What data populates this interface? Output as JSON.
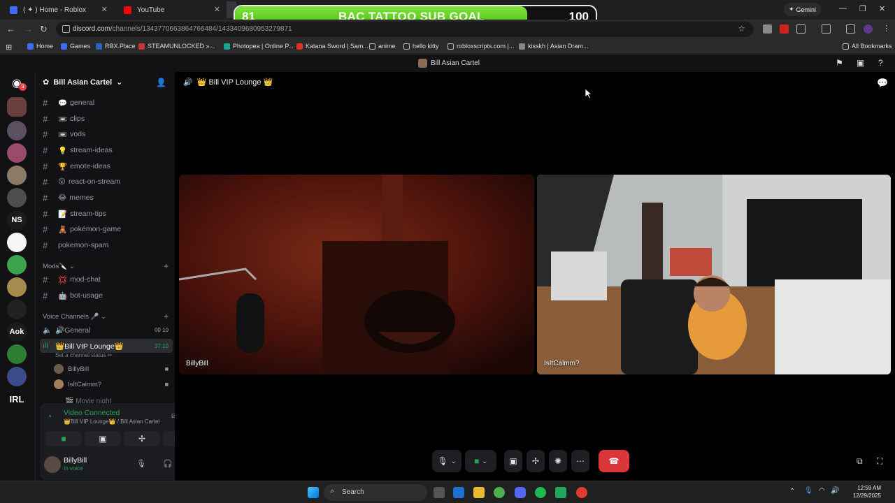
{
  "browser": {
    "tabs": [
      {
        "title": "( ✦ ) Home - Roblox"
      },
      {
        "title": "YouTube"
      }
    ],
    "gemini_label": "Gemini",
    "url_host": "discord.com",
    "url_path": "/channels/1343770663864766484/1433409680953279871",
    "bookmarks": [
      {
        "label": "Home"
      },
      {
        "label": "Games"
      },
      {
        "label": "RBX.Place"
      },
      {
        "label": "STEAMUNLOCKED »..."
      },
      {
        "label": "Photopea | Online P..."
      },
      {
        "label": "Katana Sword | Sam..."
      },
      {
        "label": "anime"
      },
      {
        "label": "hello kitty"
      },
      {
        "label": "robloxscripts.com |..."
      },
      {
        "label": "kisskh | Asian Dram..."
      }
    ],
    "all_bookmarks": "All Bookmarks"
  },
  "sub_goal": {
    "current": "81",
    "target": "100",
    "label": "BAC TATTOO SUB GOAL",
    "progress_fraction": 0.81
  },
  "discord": {
    "window_title": "Bill Asian Cartel",
    "notif_count": "3",
    "server_name": "Bill Asian Cartel",
    "rail_labels": {
      "ns": "NS",
      "aok": "Aok",
      "irl": "IRL"
    },
    "channels": [
      {
        "emoji": "💬",
        "name": "general"
      },
      {
        "emoji": "📼",
        "name": "clips"
      },
      {
        "emoji": "📼",
        "name": "vods"
      },
      {
        "emoji": "💡",
        "name": "stream-ideas"
      },
      {
        "emoji": "🏆",
        "name": "emote-ideas"
      },
      {
        "emoji": "😲",
        "name": "react-on-stream"
      },
      {
        "emoji": "😂",
        "name": "memes"
      },
      {
        "emoji": "📝",
        "name": "stream-tips"
      },
      {
        "emoji": "🧸",
        "name": "pokémon-game"
      },
      {
        "emoji": "",
        "name": "pokemon-spam"
      }
    ],
    "mods_category": "Mods🔪",
    "mod_channels": [
      {
        "emoji": "💢",
        "name": "mod-chat"
      },
      {
        "emoji": "🤖",
        "name": "bot-usage"
      }
    ],
    "voice_category": "Voice Channels 🎤",
    "voice_channels": [
      {
        "name": "🔊General",
        "badge": "00 10"
      },
      {
        "name": "👑Bill VIP Lounge👑",
        "badge": "37:10",
        "status": "Set a channel status ✏"
      }
    ],
    "voice_users": [
      {
        "name": "BillyBill"
      },
      {
        "name": "IsItCalmm?"
      }
    ],
    "next_channel": "🎬 Movie night",
    "connection": {
      "status": "Video Connected",
      "location": "👑Bill VIP Lounge👑 / Bill Asian Cartel"
    },
    "user": {
      "name": "BillyBill",
      "status": "In voice"
    },
    "call_header": "👑 Bill VIP Lounge 👑",
    "participants": [
      {
        "name": "BillyBill"
      },
      {
        "name": "IsItCalmm?"
      }
    ]
  },
  "taskbar": {
    "search_placeholder": "Search",
    "time": "12:59 AM",
    "date": "12/29/2025"
  }
}
